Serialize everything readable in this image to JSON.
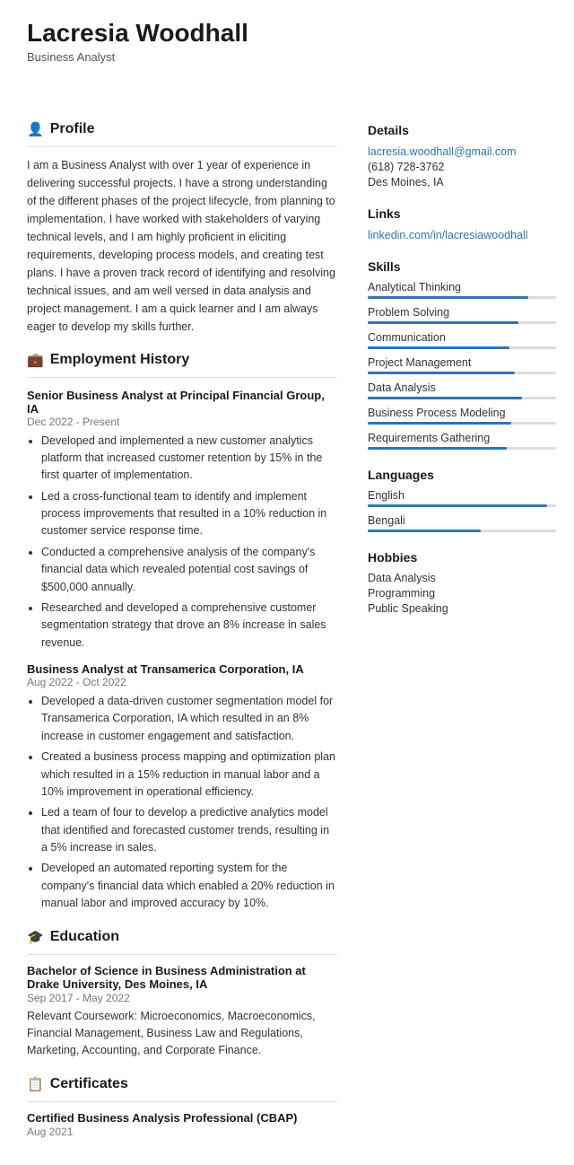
{
  "header": {
    "name": "Lacresia Woodhall",
    "subtitle": "Business Analyst"
  },
  "profile": {
    "section_label": "Profile",
    "icon": "👤",
    "text": "I am a Business Analyst with over 1 year of experience in delivering successful projects. I have a strong understanding of the different phases of the project lifecycle, from planning to implementation. I have worked with stakeholders of varying technical levels, and I am highly proficient in eliciting requirements, developing process models, and creating test plans. I have a proven track record of identifying and resolving technical issues, and am well versed in data analysis and project management. I am a quick learner and I am always eager to develop my skills further."
  },
  "employment": {
    "section_label": "Employment History",
    "icon": "💼",
    "jobs": [
      {
        "title": "Senior Business Analyst at Principal Financial Group, IA",
        "date": "Dec 2022 - Present",
        "bullets": [
          "Developed and implemented a new customer analytics platform that increased customer retention by 15% in the first quarter of implementation.",
          "Led a cross-functional team to identify and implement process improvements that resulted in a 10% reduction in customer service response time.",
          "Conducted a comprehensive analysis of the company's financial data which revealed potential cost savings of $500,000 annually.",
          "Researched and developed a comprehensive customer segmentation strategy that drove an 8% increase in sales revenue."
        ]
      },
      {
        "title": "Business Analyst at Transamerica Corporation, IA",
        "date": "Aug 2022 - Oct 2022",
        "bullets": [
          "Developed a data-driven customer segmentation model for Transamerica Corporation, IA which resulted in an 8% increase in customer engagement and satisfaction.",
          "Created a business process mapping and optimization plan which resulted in a 15% reduction in manual labor and a 10% improvement in operational efficiency.",
          "Led a team of four to develop a predictive analytics model that identified and forecasted customer trends, resulting in a 5% increase in sales.",
          "Developed an automated reporting system for the company's financial data which enabled a 20% reduction in manual labor and improved accuracy by 10%."
        ]
      }
    ]
  },
  "education": {
    "section_label": "Education",
    "icon": "🎓",
    "items": [
      {
        "title": "Bachelor of Science in Business Administration at Drake University, Des Moines, IA",
        "date": "Sep 2017 - May 2022",
        "text": "Relevant Coursework: Microeconomics, Macroeconomics, Financial Management, Business Law and Regulations, Marketing, Accounting, and Corporate Finance."
      }
    ]
  },
  "certificates": {
    "section_label": "Certificates",
    "icon": "📋",
    "items": [
      {
        "title": "Certified Business Analysis Professional (CBAP)",
        "date": "Aug 2021"
      }
    ]
  },
  "details": {
    "section_label": "Details",
    "email": "lacresia.woodhall@gmail.com",
    "phone": "(618) 728-3762",
    "location": "Des Moines, IA"
  },
  "links": {
    "section_label": "Links",
    "linkedin": "linkedin.com/in/lacresiawoodhall"
  },
  "skills": {
    "section_label": "Skills",
    "items": [
      {
        "label": "Analytical Thinking",
        "pct": 85
      },
      {
        "label": "Problem Solving",
        "pct": 80
      },
      {
        "label": "Communication",
        "pct": 75
      },
      {
        "label": "Project Management",
        "pct": 78
      },
      {
        "label": "Data Analysis",
        "pct": 82
      },
      {
        "label": "Business Process Modeling",
        "pct": 76
      },
      {
        "label": "Requirements Gathering",
        "pct": 74
      }
    ]
  },
  "languages": {
    "section_label": "Languages",
    "items": [
      {
        "label": "English",
        "pct": 95
      },
      {
        "label": "Bengali",
        "pct": 60
      }
    ]
  },
  "hobbies": {
    "section_label": "Hobbies",
    "items": [
      "Data Analysis",
      "Programming",
      "Public Speaking"
    ]
  }
}
